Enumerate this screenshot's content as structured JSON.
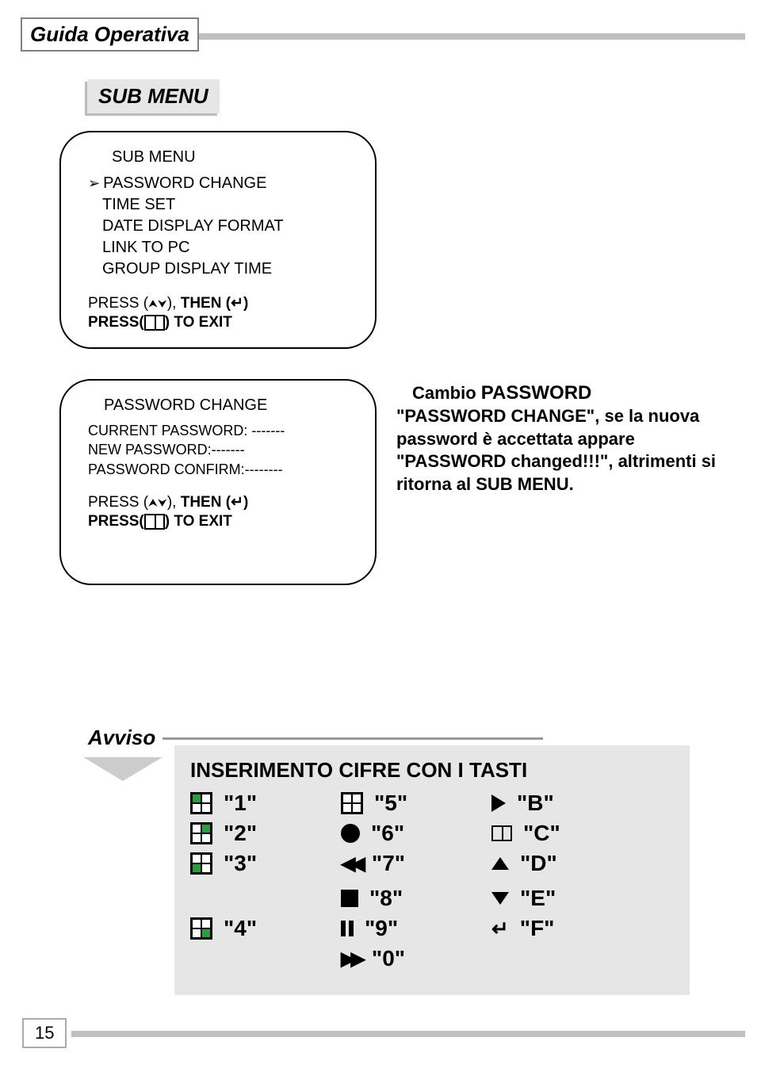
{
  "header": {
    "section_title": "Guida Operativa",
    "submenu_label": "SUB MENU"
  },
  "panel1": {
    "title": "SUB MENU",
    "items": [
      "PASSWORD CHANGE",
      "TIME  SET",
      "DATE DISPLAY FORMAT",
      "LINK TO PC",
      "GROUP DISPLAY TIME"
    ],
    "press_prefix": "PRESS (",
    "press_mid": "), ",
    "then": "THEN (",
    "enter": "↵",
    "close": ")",
    "exit_prefix": "PRESS(",
    "exit_suffix": ") TO EXIT"
  },
  "panel2": {
    "title": "PASSWORD CHANGE",
    "line1_label": "CURRENT PASSWORD: ",
    "line1_val": "-------",
    "line2_label": "NEW        PASSWORD:",
    "line2_val": "-------",
    "line3_label": "PASSWORD CONFIRM:",
    "line3_val": "--------",
    "press_prefix": "PRESS (",
    "press_mid": "), ",
    "then": "THEN (",
    "enter": "↵",
    "close": ")",
    "exit_prefix": "PRESS(",
    "exit_suffix": ") TO EXIT"
  },
  "description": {
    "title_prefix": "Cambio ",
    "title_bold": "PASSWORD",
    "body": "\"PASSWORD CHANGE\", se la nuova password è accettata appare \"PASSWORD changed!!!\", altrimenti si ritorna al SUB MENU."
  },
  "avviso": {
    "label": "Avviso",
    "title": "INSERIMENTO CIFRE CON I TASTI",
    "keys": {
      "k1": "\"1\"",
      "k2": "\"2\"",
      "k3": "\"3\"",
      "k4": "\"4\"",
      "k5": "\"5\"",
      "k6": "\"6\"",
      "k7": "\"7\"",
      "k8": "\"8\"",
      "k9": "\"9\"",
      "k0": "\"0\"",
      "kB": "\"B\"",
      "kC": "\"C\"",
      "kD": "\"D\"",
      "kE": "\"E\"",
      "kF": "\"F\""
    }
  },
  "page_number": "15"
}
